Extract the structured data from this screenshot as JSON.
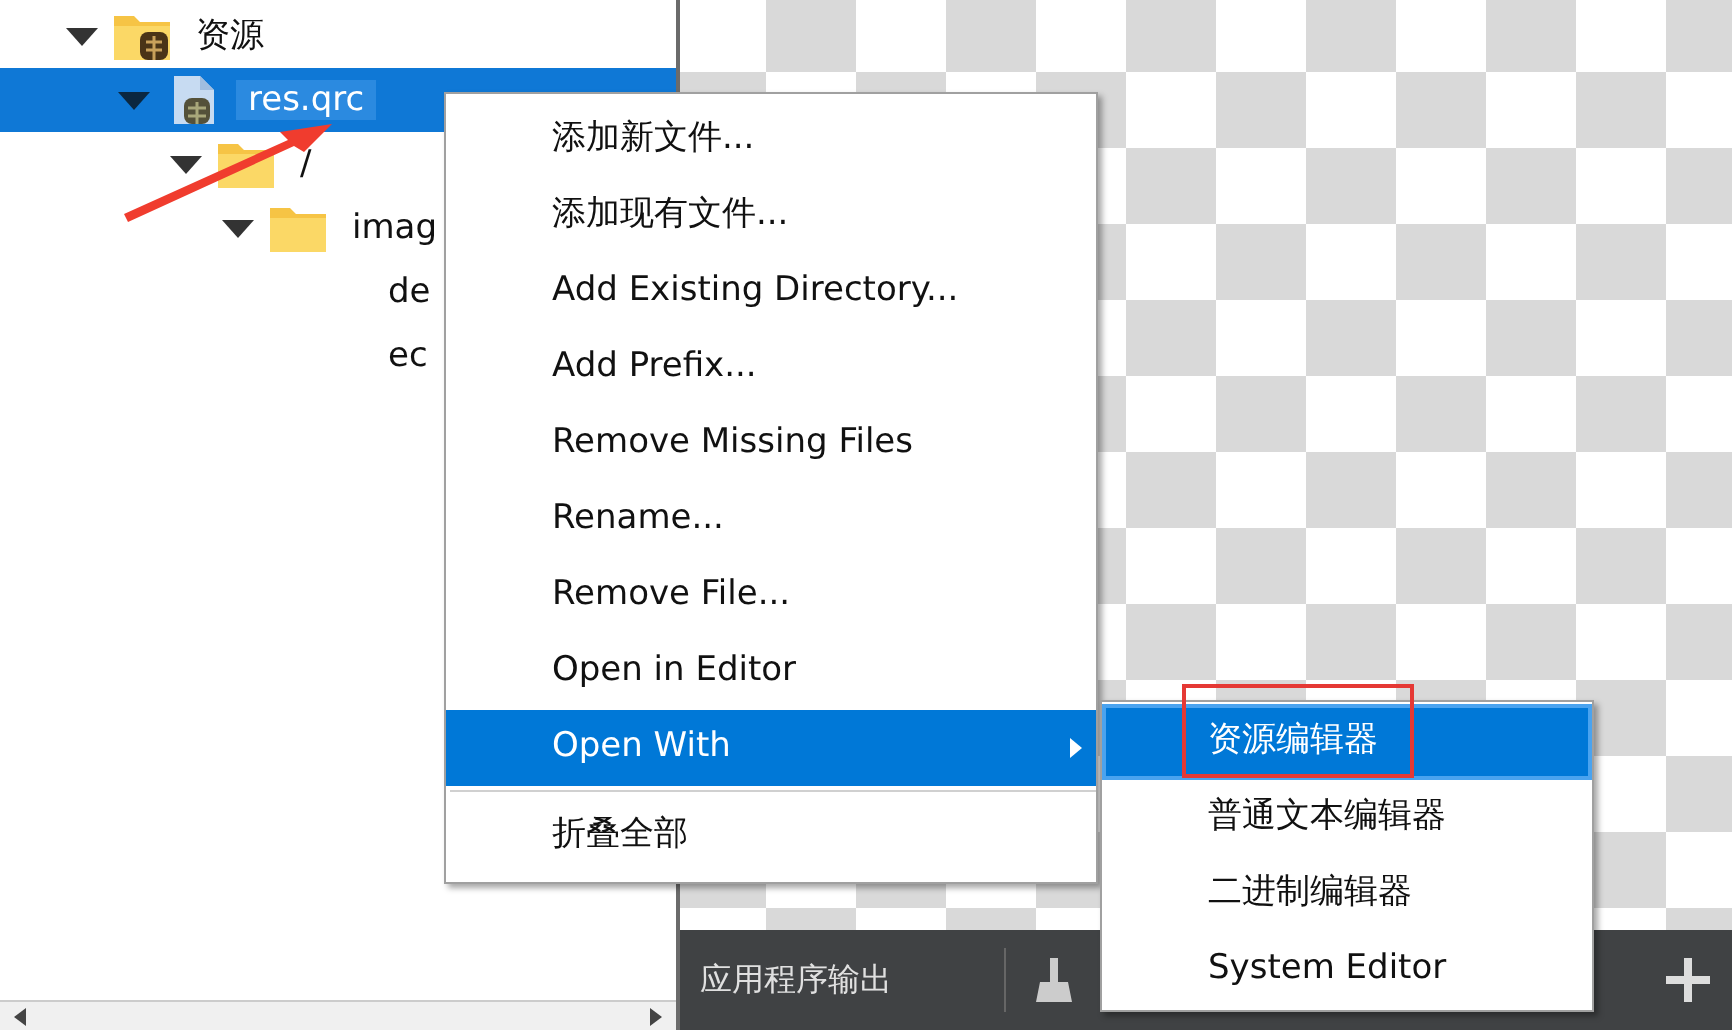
{
  "tree": [
    {
      "label": "资源",
      "kind": "resource-folder",
      "expanded": true,
      "selected": false,
      "children": [
        {
          "label": "res.qrc",
          "kind": "qrc-file",
          "expanded": true,
          "selected": true,
          "children": [
            {
              "label": "/",
              "kind": "folder",
              "expanded": true,
              "selected": false,
              "children": [
                {
                  "label": "imag",
                  "kind": "folder",
                  "expanded": true,
                  "selected": false,
                  "children": [
                    {
                      "label": "de",
                      "selected": false
                    },
                    {
                      "label": "ec",
                      "selected": false
                    }
                  ]
                }
              ]
            }
          ]
        }
      ]
    }
  ],
  "context_menu": {
    "items": [
      {
        "kind": "item",
        "label": "添加新文件...",
        "selected": false,
        "submenu": false
      },
      {
        "kind": "item",
        "label": "添加现有文件...",
        "selected": false,
        "submenu": false
      },
      {
        "kind": "item",
        "label": "Add Existing Directory...",
        "selected": false,
        "submenu": false
      },
      {
        "kind": "item",
        "label": "Add Prefix...",
        "selected": false,
        "submenu": false
      },
      {
        "kind": "item",
        "label": "Remove Missing Files",
        "selected": false,
        "submenu": false
      },
      {
        "kind": "item",
        "label": "Rename...",
        "selected": false,
        "submenu": false
      },
      {
        "kind": "item",
        "label": "Remove File...",
        "selected": false,
        "submenu": false
      },
      {
        "kind": "item",
        "label": "Open in Editor",
        "selected": false,
        "submenu": false
      },
      {
        "kind": "item",
        "label": "Open With",
        "selected": true,
        "submenu": true
      },
      {
        "kind": "separator"
      },
      {
        "kind": "item",
        "label": "折叠全部",
        "selected": false,
        "submenu": false
      }
    ]
  },
  "submenu": {
    "items": [
      {
        "label": "资源编辑器",
        "selected": true
      },
      {
        "label": "普通文本编辑器",
        "selected": false
      },
      {
        "label": "二进制编辑器",
        "selected": false
      },
      {
        "label": "System Editor",
        "selected": false
      }
    ]
  },
  "output_bar": {
    "title": "应用程序输出"
  }
}
